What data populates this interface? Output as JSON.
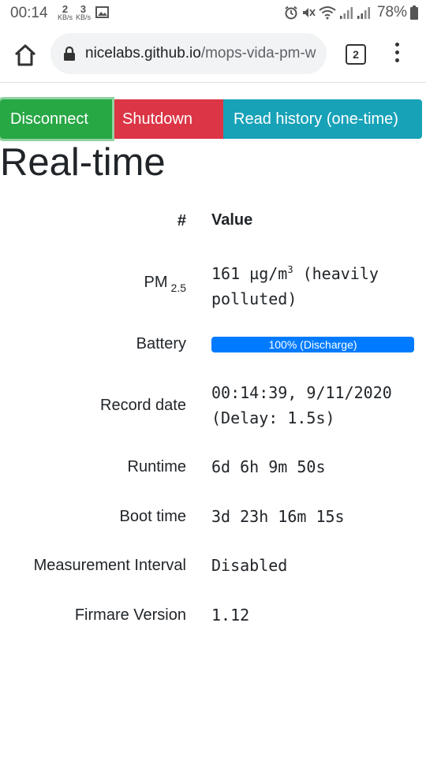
{
  "status_bar": {
    "time": "00:14",
    "net_down": "2",
    "net_down_unit": "KB/s",
    "net_up": "3",
    "net_up_unit": "KB/s",
    "battery_pct": "78%",
    "icons": [
      "image-icon",
      "alarm-icon",
      "mute-icon",
      "wifi-icon",
      "signal-icon",
      "signal-icon-2",
      "battery-icon"
    ]
  },
  "browser": {
    "url_host": "nicelabs.github.io",
    "url_path": "/mops-vida-pm-w",
    "tab_count": "2"
  },
  "buttons": {
    "disconnect": "Disconnect",
    "shutdown": "Shutdown",
    "read_history": "Read history (one-time)"
  },
  "heading": "Real-time",
  "table": {
    "col_label": "#",
    "col_value": "Value",
    "pm_label": "PM",
    "pm_sub": "2.5",
    "pm_value_line1": "161 µg/m",
    "pm_value_sup": "3",
    "pm_value_line1_tail": " (heavily",
    "pm_value_line2": "polluted)",
    "battery_label": "Battery",
    "battery_text": "100% (Discharge)",
    "battery_level": 1.0,
    "record_label": "Record date",
    "record_line1": "00:14:39, 9/11/2020",
    "record_line2": "(Delay: 1.5s)",
    "runtime_label": "Runtime",
    "runtime_value": "6d 6h 9m 50s",
    "boot_label": "Boot time",
    "boot_value": "3d 23h 16m 15s",
    "interval_label": "Measurement Interval",
    "interval_value": "Disabled",
    "firmware_label": "Firmare Version",
    "firmware_value": "1.12"
  },
  "colors": {
    "green": "#28a745",
    "red": "#dc3545",
    "teal": "#17a2b8",
    "progress": "#007bff"
  }
}
